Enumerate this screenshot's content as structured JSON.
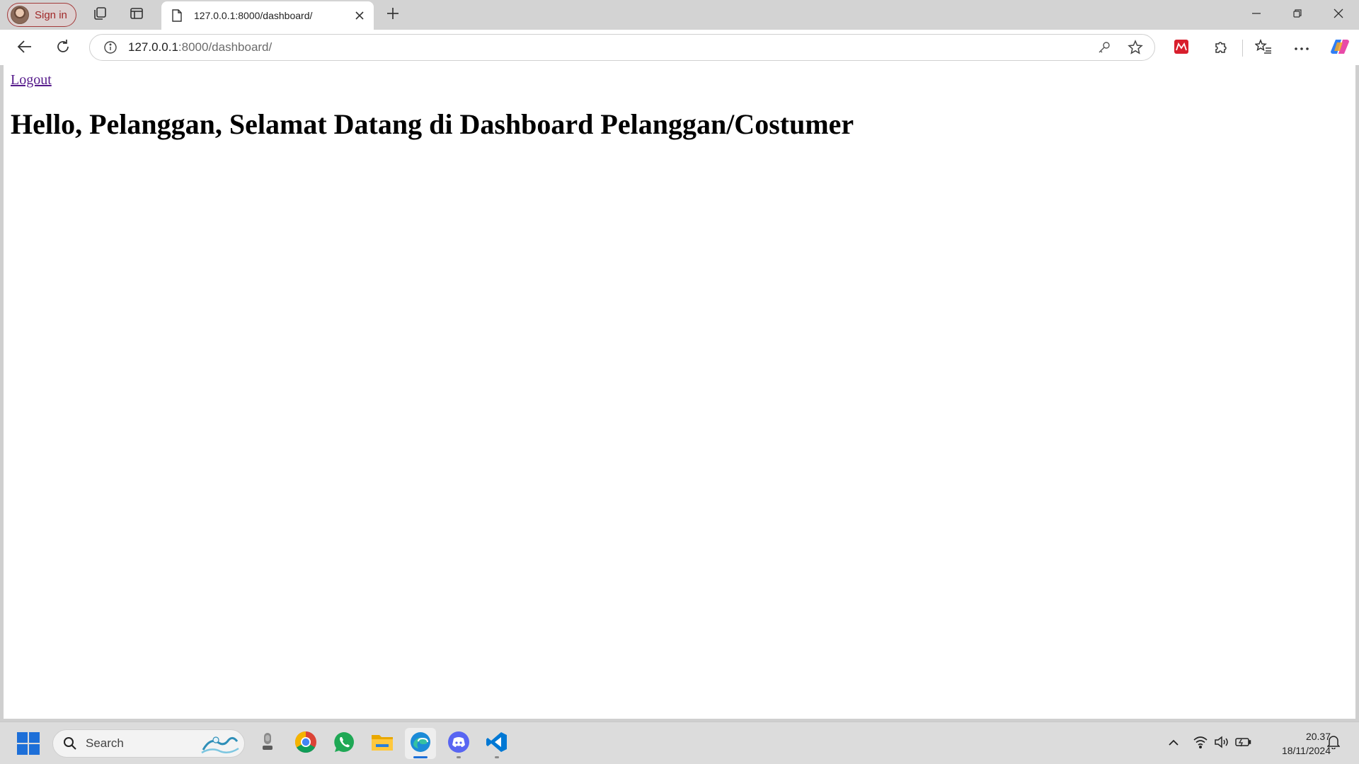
{
  "browser": {
    "profile": {
      "sign_in_label": "Sign in"
    },
    "tab": {
      "title": "127.0.0.1:8000/dashboard/"
    },
    "address": {
      "url_host": "127.0.0.1",
      "url_path": ":8000/dashboard/"
    }
  },
  "page": {
    "logout_label": "Logout",
    "heading": "Hello, Pelanggan, Selamat Datang di Dashboard Pelanggan/Costumer",
    "link_color": "#551a8b"
  },
  "taskbar": {
    "search_label": "Search",
    "apps": [
      "chrome-icon",
      "whatsapp-icon",
      "file-explorer-icon",
      "edge-icon",
      "discord-icon",
      "vscode-icon"
    ],
    "clock": {
      "time": "20.37",
      "date": "18/11/2024"
    }
  },
  "colors": {
    "accent": "#1d6fd8",
    "signin_border": "#a33a3a"
  }
}
